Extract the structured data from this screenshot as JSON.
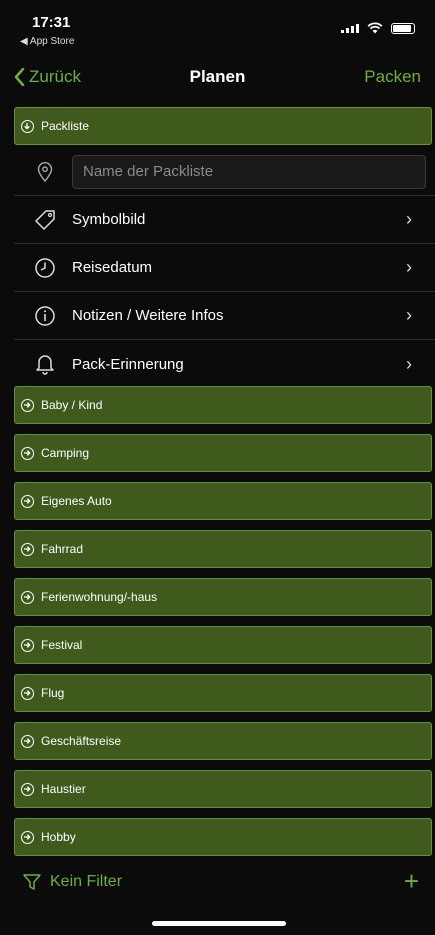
{
  "status_bar": {
    "time": "17:31",
    "back_app": "◀ App Store"
  },
  "nav": {
    "back_label": "Zurück",
    "title": "Planen",
    "action_label": "Packen"
  },
  "packliste": {
    "header": "Packliste",
    "name_placeholder": "Name der Packliste",
    "rows": [
      {
        "label": "Symbolbild",
        "icon": "tag-icon"
      },
      {
        "label": "Reisedatum",
        "icon": "clock-icon"
      },
      {
        "label": "Notizen / Weitere Infos",
        "icon": "info-icon"
      },
      {
        "label": "Pack-Erinnerung",
        "icon": "bell-icon"
      }
    ]
  },
  "categories": [
    "Baby / Kind",
    "Camping",
    "Eigenes Auto",
    "Fahrrad",
    "Ferienwohnung/-haus",
    "Festival",
    "Flug",
    "Geschäftsreise",
    "Haustier",
    "Hobby"
  ],
  "bottom_bar": {
    "filter_label": "Kein Filter",
    "add_label": "+"
  },
  "colors": {
    "accent": "#6fae3a",
    "section_bg": "#3f5a1c",
    "section_border": "#6b8f38",
    "background": "#0b0b0b"
  }
}
